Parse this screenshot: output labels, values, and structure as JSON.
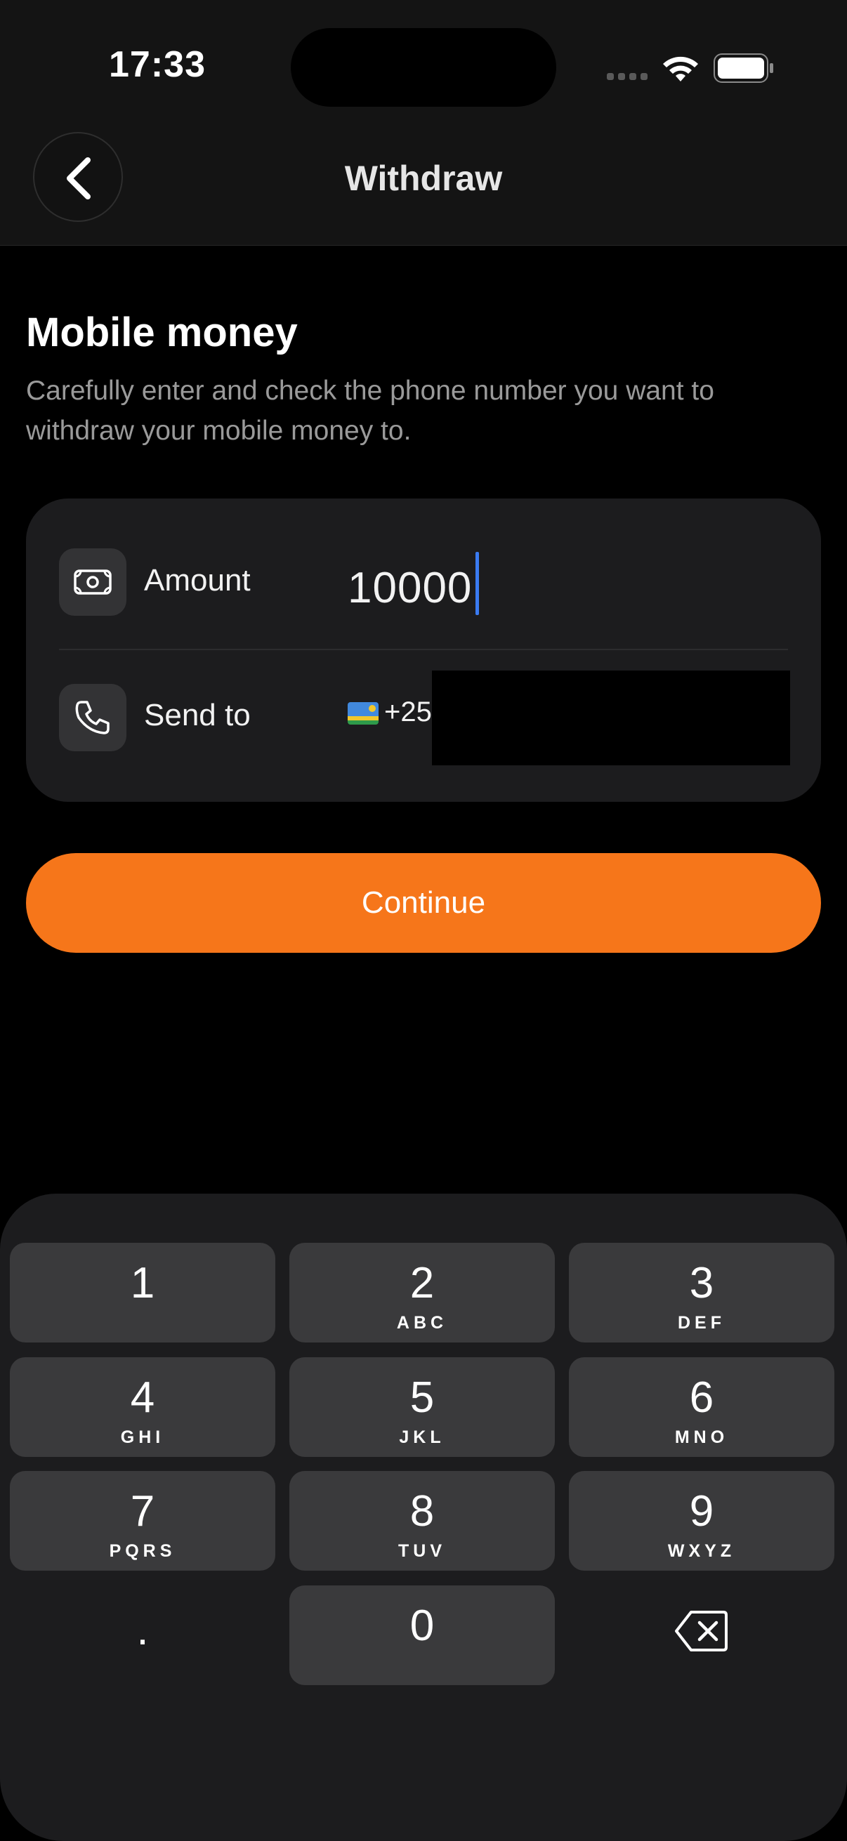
{
  "status_bar": {
    "time": "17:33"
  },
  "header": {
    "title": "Withdraw"
  },
  "section": {
    "title": "Mobile money",
    "description": "Carefully enter and check the phone number you want to withdraw your mobile money to."
  },
  "form": {
    "amount_label": "Amount",
    "amount_value": "10000",
    "send_to_label": "Send to",
    "phone_prefix": "+25"
  },
  "continue_label": "Continue",
  "keypad": {
    "keys": [
      {
        "digit": "1",
        "letters": ""
      },
      {
        "digit": "2",
        "letters": "ABC"
      },
      {
        "digit": "3",
        "letters": "DEF"
      },
      {
        "digit": "4",
        "letters": "GHI"
      },
      {
        "digit": "5",
        "letters": "JKL"
      },
      {
        "digit": "6",
        "letters": "MNO"
      },
      {
        "digit": "7",
        "letters": "PQRS"
      },
      {
        "digit": "8",
        "letters": "TUV"
      },
      {
        "digit": "9",
        "letters": "WXYZ"
      },
      {
        "digit": ".",
        "letters": ""
      },
      {
        "digit": "0",
        "letters": ""
      }
    ]
  },
  "colors": {
    "accent": "#f6761a",
    "caret": "#3a7bf2"
  },
  "icons": [
    "back-chevron-icon",
    "cash-icon",
    "phone-icon",
    "flag-icon",
    "delete-icon",
    "wifi-icon",
    "battery-icon",
    "signal-icon"
  ]
}
